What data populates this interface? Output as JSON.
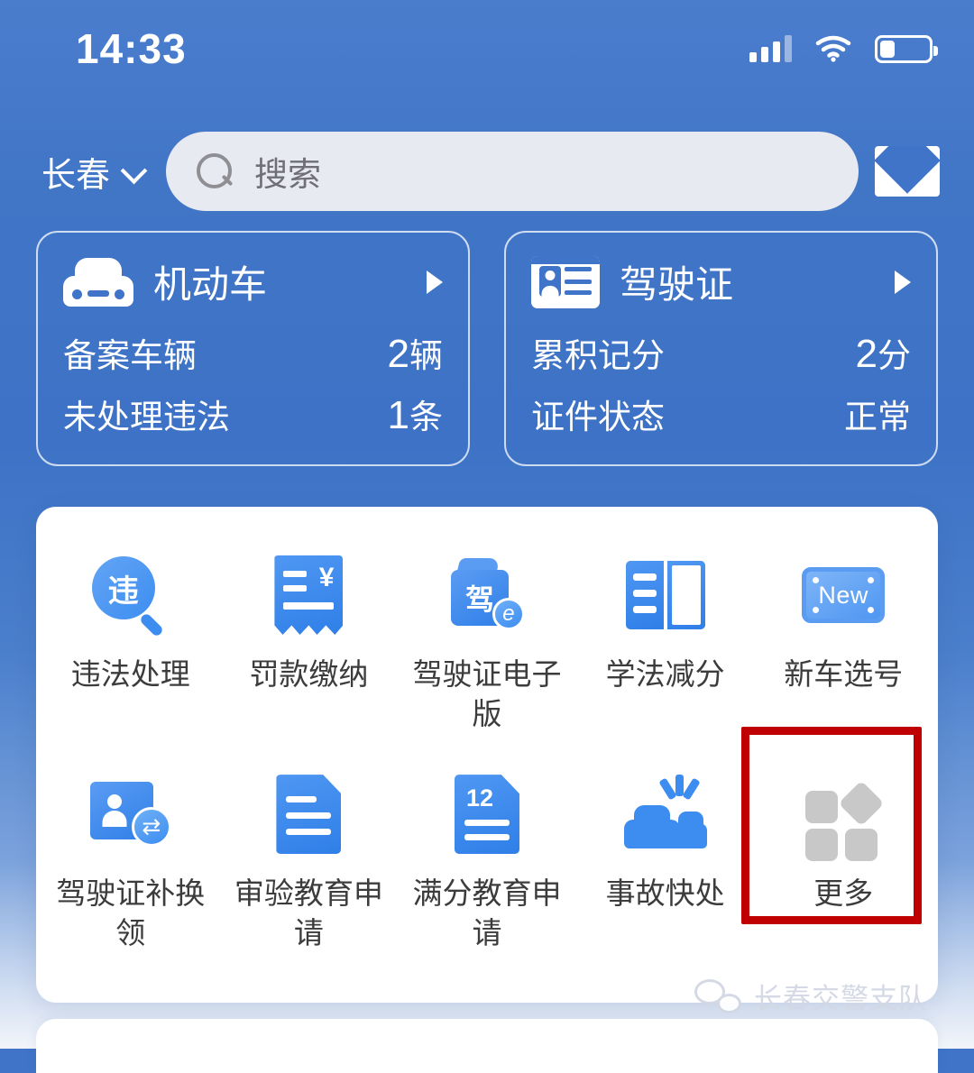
{
  "statusbar": {
    "time": "14:33",
    "signal_icon": "signal-bars-icon",
    "wifi_icon": "wifi-icon",
    "battery_icon": "battery-icon",
    "battery_level_pct": 30
  },
  "topbar": {
    "city": "长春",
    "city_chevron_icon": "chevron-down-icon",
    "search_placeholder": "搜索",
    "search_value": "",
    "search_icon": "search-icon",
    "mail_icon": "mail-icon"
  },
  "cards": [
    {
      "icon": "car-icon",
      "title": "机动车",
      "arrow_icon": "chevron-right-icon",
      "rows": [
        {
          "label": "备案车辆",
          "num": "2",
          "unit": "辆"
        },
        {
          "label": "未处理违法",
          "num": "1",
          "unit": "条"
        }
      ]
    },
    {
      "icon": "id-card-icon",
      "title": "驾驶证",
      "arrow_icon": "chevron-right-icon",
      "rows": [
        {
          "label": "累积记分",
          "num": "2",
          "unit": "分"
        },
        {
          "label": "证件状态",
          "num": "",
          "unit": "正常"
        }
      ]
    }
  ],
  "services": [
    {
      "label": "违法处理",
      "icon": "violation-search-icon",
      "glyph_text": "违"
    },
    {
      "label": "罚款缴纳",
      "icon": "fine-receipt-icon",
      "glyph_text": "¥"
    },
    {
      "label": "驾驶证电子版",
      "icon": "e-license-wallet-icon",
      "glyph_text": "驾"
    },
    {
      "label": "学法减分",
      "icon": "open-book-icon",
      "glyph_text": ""
    },
    {
      "label": "新车选号",
      "icon": "license-plate-icon",
      "glyph_text": "New"
    },
    {
      "label": "驾驶证补换领",
      "icon": "license-renew-icon",
      "glyph_text": ""
    },
    {
      "label": "审验教育申请",
      "icon": "document-icon",
      "glyph_text": ""
    },
    {
      "label": "满分教育申请",
      "icon": "document-12-icon",
      "glyph_text": "12"
    },
    {
      "label": "事故快处",
      "icon": "car-crash-icon",
      "glyph_text": ""
    },
    {
      "label": "更多",
      "icon": "more-grid-icon",
      "glyph_text": ""
    }
  ],
  "annotation": {
    "highlight_target": "更多",
    "box_color": "#c00000"
  },
  "watermark": {
    "text": "长春交警支队",
    "icon": "wechat-icon"
  },
  "colors": {
    "background_top": "#4b7dcd",
    "background_bottom": "#f2f5fa",
    "panel": "#ffffff",
    "icon_blue": "#3d8df0",
    "accent_red": "#c00000",
    "search_field": "#e7eaf1"
  }
}
